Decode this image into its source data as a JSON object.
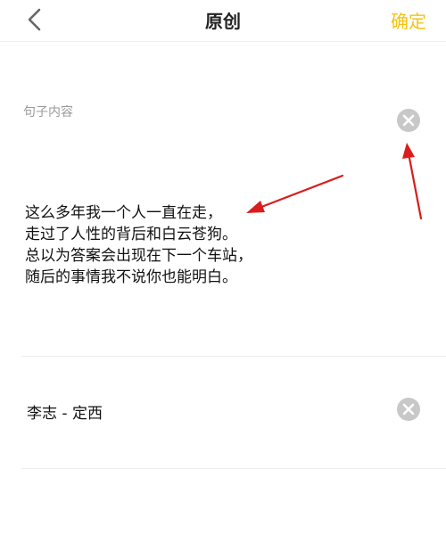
{
  "navbar": {
    "title": "原创",
    "confirm_label": "确定",
    "back_icon": "chevron-left-icon"
  },
  "sentence": {
    "label": "句子内容",
    "lines": [
      "这么多年我一个人一直在走，",
      "走过了人性的背后和白云苍狗。",
      "总以为答案会出现在下一个车站，",
      "随后的事情我不说你也能明白。"
    ],
    "clear_icon": "clear-circle-icon"
  },
  "author": {
    "value": "李志 - 定西",
    "clear_icon": "clear-circle-icon"
  },
  "colors": {
    "accent": "#f5c310",
    "annotation": "#d81e1e",
    "label": "#999999",
    "clear_icon": "#c8c8c8"
  }
}
